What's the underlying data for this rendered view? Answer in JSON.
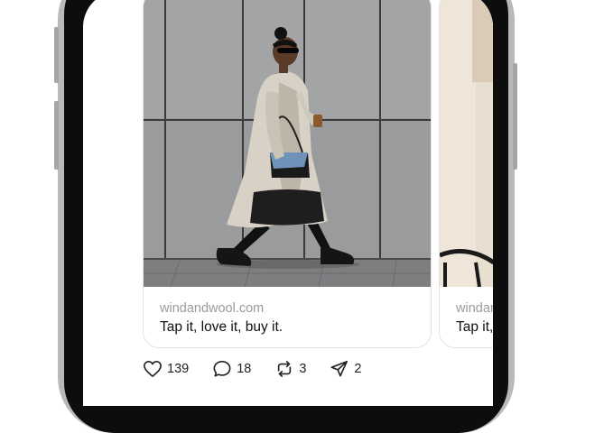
{
  "post_cards": [
    {
      "domain": "windandwool.com",
      "caption": "Tap it, love it, buy it."
    },
    {
      "domain": "windandwool.com",
      "caption": "Tap it, love it, buy it."
    }
  ],
  "actions": {
    "like": {
      "icon": "heart-icon",
      "count": "139"
    },
    "reply": {
      "icon": "speech-bubble-icon",
      "count": "18"
    },
    "repost": {
      "icon": "repost-icon",
      "count": "3"
    },
    "share": {
      "icon": "send-icon",
      "count": "2"
    }
  },
  "colors": {
    "phone_frame": "#0d0d0d",
    "phone_edge": "#b9b9bb",
    "domain_text": "#9a9a9a",
    "caption_text": "#111111",
    "card_border": "#e3e3e3"
  }
}
